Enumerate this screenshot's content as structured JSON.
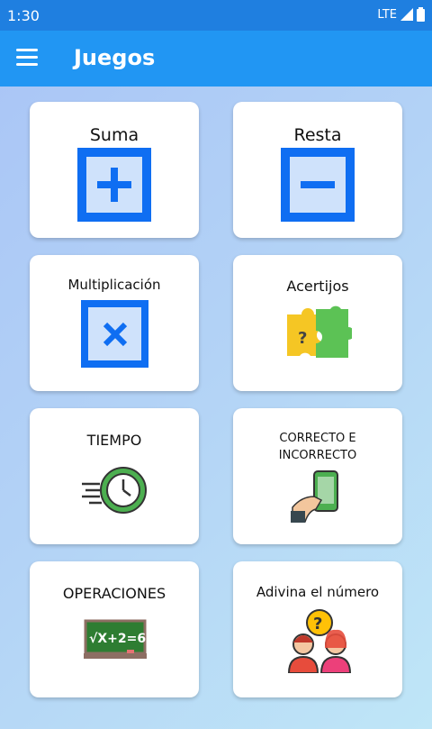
{
  "status_bar": {
    "time": "1:30",
    "network": "LTE"
  },
  "app_bar": {
    "title": "Juegos"
  },
  "cards": [
    {
      "label": "Suma"
    },
    {
      "label": "Resta"
    },
    {
      "label": "Multiplicación"
    },
    {
      "label": "Acertijos"
    },
    {
      "label": "TIEMPO"
    },
    {
      "label": "CORRECTO E\nINCORRECTO"
    },
    {
      "label": "OPERACIONES"
    },
    {
      "label": "Adivina el número"
    }
  ],
  "chalkboard_text": "√X+2=6",
  "colors": {
    "primary": "#2196f3",
    "status": "#1f7fe0",
    "icon_blue": "#0f6ef2",
    "icon_fill": "#cfe2fb"
  }
}
